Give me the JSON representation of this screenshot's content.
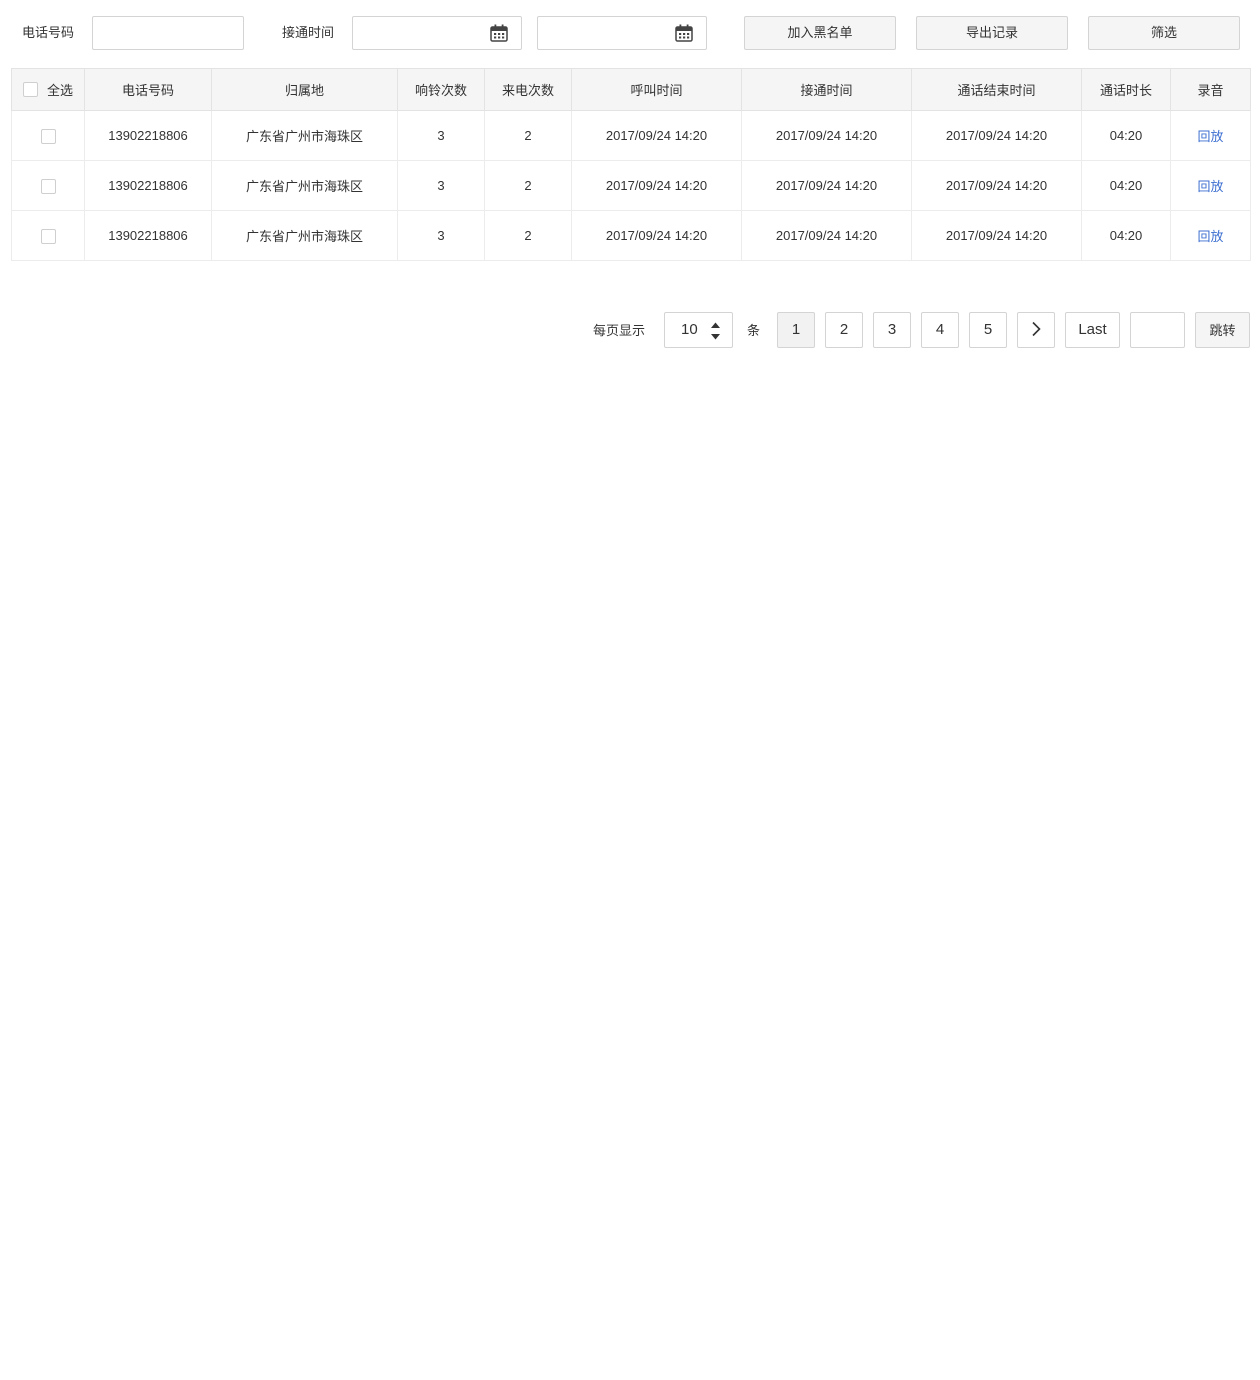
{
  "filters": {
    "phone_label": "电话号码",
    "phone_value": "",
    "connect_time_label": "接通时间",
    "date_start_value": "",
    "date_end_value": ""
  },
  "actions": {
    "blacklist": "加入黑名单",
    "export": "导出记录",
    "filter": "筛选"
  },
  "table": {
    "select_all": "全选",
    "columns": [
      "电话号码",
      "归属地",
      "响铃次数",
      "来电次数",
      "呼叫时间",
      "接通时间",
      "通话结束时间",
      "通话时长",
      "录音"
    ],
    "rows": [
      {
        "phone": "13902218806",
        "location": "广东省广州市海珠区",
        "rings": "3",
        "calls": "2",
        "call_time": "2017/09/24 14:20",
        "connect_time": "2017/09/24 14:20",
        "end_time": "2017/09/24 14:20",
        "duration": "04:20",
        "record": "回放"
      },
      {
        "phone": "13902218806",
        "location": "广东省广州市海珠区",
        "rings": "3",
        "calls": "2",
        "call_time": "2017/09/24 14:20",
        "connect_time": "2017/09/24 14:20",
        "end_time": "2017/09/24 14:20",
        "duration": "04:20",
        "record": "回放"
      },
      {
        "phone": "13902218806",
        "location": "广东省广州市海珠区",
        "rings": "3",
        "calls": "2",
        "call_time": "2017/09/24 14:20",
        "connect_time": "2017/09/24 14:20",
        "end_time": "2017/09/24 14:20",
        "duration": "04:20",
        "record": "回放"
      }
    ]
  },
  "pagination": {
    "per_page_label": "每页显示",
    "per_page_value": "10",
    "unit": "条",
    "pages": [
      "1",
      "2",
      "3",
      "4",
      "5"
    ],
    "current_page": "1",
    "last": "Last",
    "jump_value": "",
    "jump": "跳转"
  },
  "colors": {
    "link": "#3d6fd1",
    "header_bg": "#f5f5f5",
    "border": "#e3e3e3"
  },
  "icons": [
    "calendar-icon",
    "chevron-right-icon",
    "spinner-up-icon",
    "spinner-down-icon"
  ]
}
